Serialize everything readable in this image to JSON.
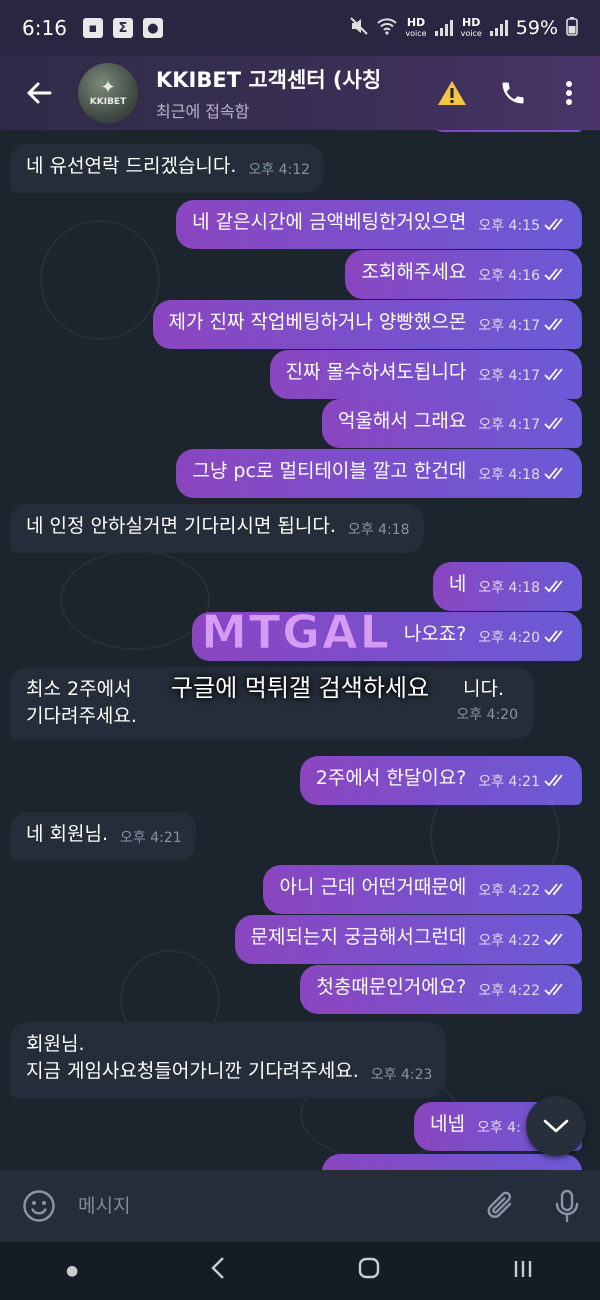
{
  "status_bar": {
    "time": "6:16",
    "notif_icons": [
      "image-icon",
      "sigma-icon",
      "contact-icon"
    ],
    "hd1": "HD",
    "hd2": "HD",
    "hd_voice": "voice",
    "battery": "59%"
  },
  "header": {
    "title": "KKIBET 고객센터 (사칭",
    "subtitle": "최근에 접속함",
    "avatar_text": "KKIBET"
  },
  "messages": [
    {
      "dir": "in",
      "text": "네 유선연락 드리겠습니다.",
      "time": "오후 4:12"
    },
    {
      "dir": "out",
      "text": "네 같은시간에 금액베팅한거있으면",
      "time": "오후 4:15"
    },
    {
      "dir": "out",
      "text": "조회해주세요",
      "time": "오후 4:16"
    },
    {
      "dir": "out",
      "text": "제가 진짜 작업베팅하거나 양빵했으몬",
      "time": "오후 4:17"
    },
    {
      "dir": "out",
      "text": "진짜 몰수하셔도됩니다",
      "time": "오후 4:17"
    },
    {
      "dir": "out",
      "text": "억울해서 그래요",
      "time": "오후 4:17"
    },
    {
      "dir": "out",
      "text": "그냥 pc로 멀티테이블 깔고 한건데",
      "time": "오후 4:18"
    },
    {
      "dir": "in",
      "text": "네 인정 안하실거면 기다리시면 됩니다.",
      "time": "오후 4:18"
    },
    {
      "dir": "out",
      "text": "네",
      "time": "오후 4:18"
    },
    {
      "dir": "out",
      "text": "나오죠?",
      "time": "오후 4:20"
    },
    {
      "dir": "in",
      "text": "최소 2주에서",
      "text2": "기다려주세요.",
      "tail": "니다.",
      "time": "오후 4:20"
    },
    {
      "dir": "out",
      "text": "2주에서 한달이요?",
      "time": "오후 4:21"
    },
    {
      "dir": "in",
      "text": "네 회원님.",
      "time": "오후 4:21"
    },
    {
      "dir": "out",
      "text": "아니 근데 어떤거때문에",
      "time": "오후 4:22"
    },
    {
      "dir": "out",
      "text": "문제되는지 궁금해서그런데",
      "time": "오후 4:22"
    },
    {
      "dir": "out",
      "text": "첫충때문인거에요?",
      "time": "오후 4:22"
    },
    {
      "dir": "in",
      "text": "회원님.",
      "text2": "지금 게임사요청들어가니깐 기다려주세요.",
      "time": "오후 4:23"
    },
    {
      "dir": "out",
      "text": "네넵",
      "time": "오후 4:"
    }
  ],
  "watermark": {
    "logo": "MTGAL",
    "text": "구글에 먹튀갤 검색하세요"
  },
  "input": {
    "placeholder": "메시지"
  },
  "icons": {
    "back": "back-arrow-icon",
    "warning": "warning-icon",
    "call": "phone-icon",
    "menu": "more-vert-icon",
    "scroll": "chevron-down-icon",
    "emoji": "emoji-icon",
    "attach": "paperclip-icon",
    "mic": "microphone-icon"
  },
  "colors": {
    "outgoing": "#7b4fcb",
    "incoming": "#252d3a",
    "background": "#1c252e"
  }
}
